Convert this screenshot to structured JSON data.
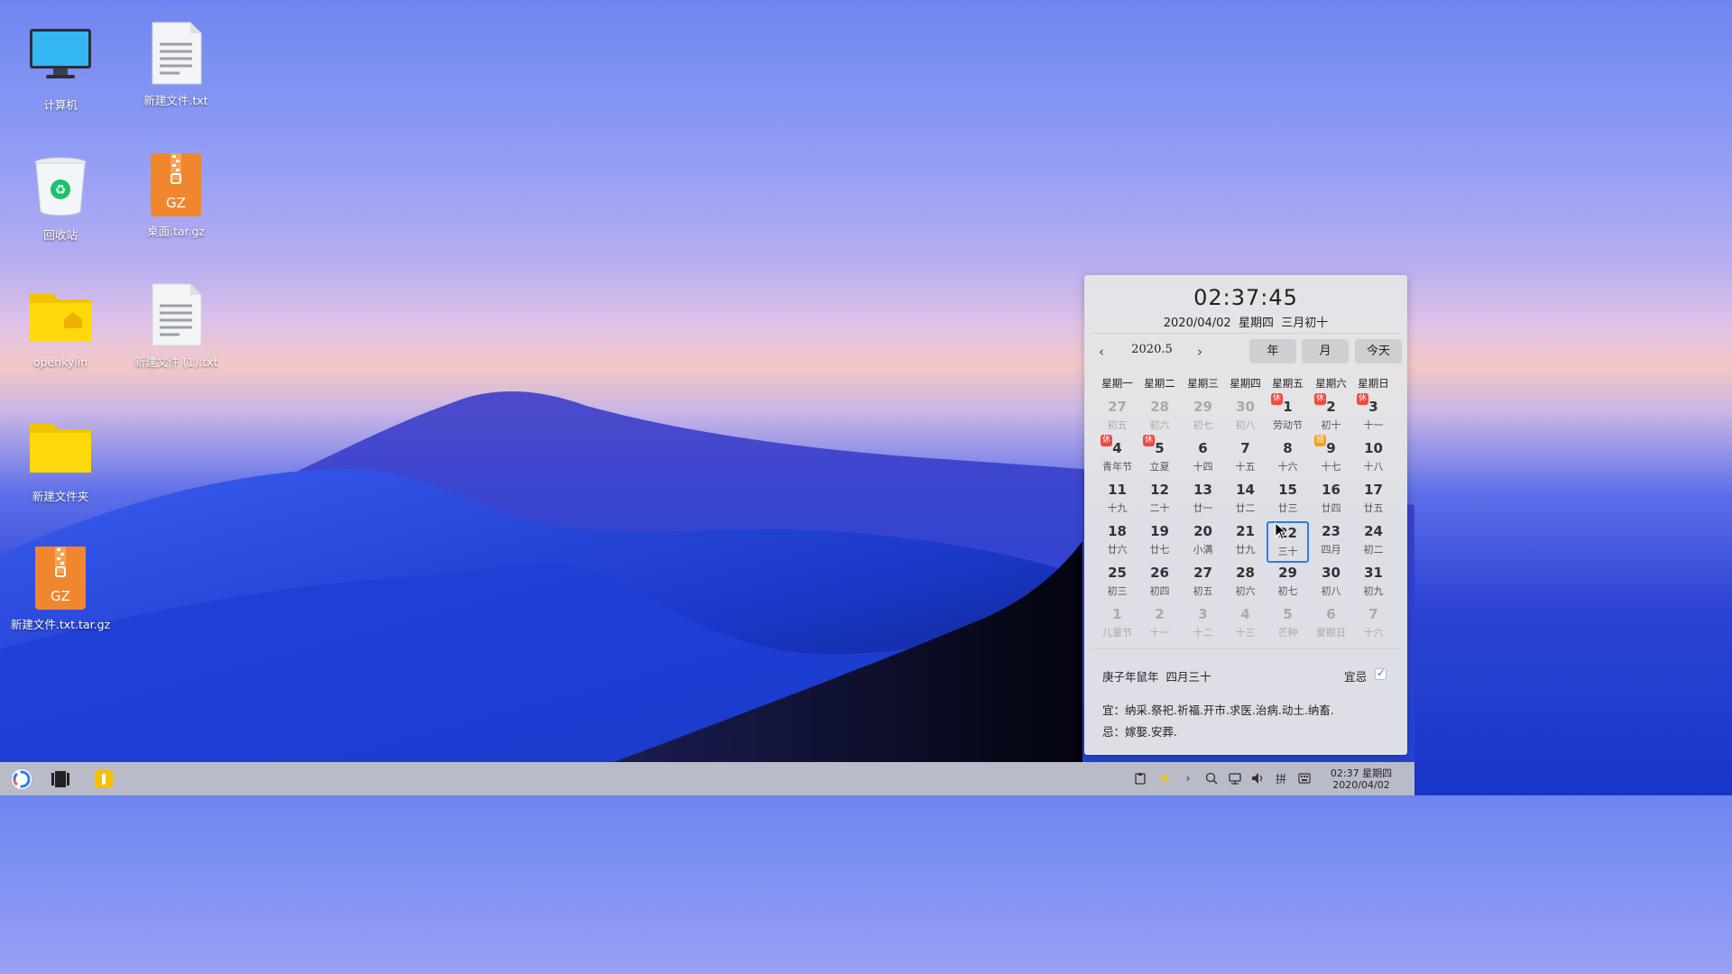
{
  "desktop": {
    "icons": [
      {
        "label": "计算机",
        "icon": "computer-icon"
      },
      {
        "label": "新建文件.txt",
        "icon": "text-file-icon"
      },
      {
        "label": "回收站",
        "icon": "trash-icon"
      },
      {
        "label": "桌面.tar.gz",
        "icon": "archive-icon",
        "badge": "GZ"
      },
      {
        "label": "openkylin",
        "icon": "home-folder-icon"
      },
      {
        "label": "新建文件 (1).txt",
        "icon": "text-file-icon"
      },
      {
        "label": "新建文件夹",
        "icon": "folder-icon"
      },
      {
        "label": "新建文件.txt.tar.gz",
        "icon": "archive-icon",
        "badge": "GZ"
      }
    ]
  },
  "calendar": {
    "time": "02:37:45",
    "date_line": "2020/04/02  星期四  三月初十",
    "month_label": "2020.5",
    "prev": "‹",
    "next": "›",
    "year_btn": "年",
    "month_btn": "月",
    "today_btn": "今天",
    "weekdays": [
      "星期一",
      "星期二",
      "星期三",
      "星期四",
      "星期五",
      "星期六",
      "星期日"
    ],
    "days": [
      {
        "n": "27",
        "l": "初五",
        "other": true
      },
      {
        "n": "28",
        "l": "初六",
        "other": true
      },
      {
        "n": "29",
        "l": "初七",
        "other": true
      },
      {
        "n": "30",
        "l": "初八",
        "other": true
      },
      {
        "n": "1",
        "l": "劳动节",
        "badge": "休",
        "badge_type": "rest"
      },
      {
        "n": "2",
        "l": "初十",
        "badge": "休",
        "badge_type": "rest"
      },
      {
        "n": "3",
        "l": "十一",
        "badge": "休",
        "badge_type": "rest"
      },
      {
        "n": "4",
        "l": "青年节",
        "badge": "休",
        "badge_type": "rest"
      },
      {
        "n": "5",
        "l": "立夏",
        "badge": "休",
        "badge_type": "rest"
      },
      {
        "n": "6",
        "l": "十四"
      },
      {
        "n": "7",
        "l": "十五"
      },
      {
        "n": "8",
        "l": "十六"
      },
      {
        "n": "9",
        "l": "十七",
        "badge": "班",
        "badge_type": "work"
      },
      {
        "n": "10",
        "l": "十八"
      },
      {
        "n": "11",
        "l": "十九"
      },
      {
        "n": "12",
        "l": "二十"
      },
      {
        "n": "13",
        "l": "廿一"
      },
      {
        "n": "14",
        "l": "廿二"
      },
      {
        "n": "15",
        "l": "廿三"
      },
      {
        "n": "16",
        "l": "廿四"
      },
      {
        "n": "17",
        "l": "廿五"
      },
      {
        "n": "18",
        "l": "廿六"
      },
      {
        "n": "19",
        "l": "廿七"
      },
      {
        "n": "20",
        "l": "小满"
      },
      {
        "n": "21",
        "l": "廿九"
      },
      {
        "n": "22",
        "l": "三十",
        "selected": true
      },
      {
        "n": "23",
        "l": "四月"
      },
      {
        "n": "24",
        "l": "初二"
      },
      {
        "n": "25",
        "l": "初三"
      },
      {
        "n": "26",
        "l": "初四"
      },
      {
        "n": "27",
        "l": "初五"
      },
      {
        "n": "28",
        "l": "初六"
      },
      {
        "n": "29",
        "l": "初七"
      },
      {
        "n": "30",
        "l": "初八"
      },
      {
        "n": "31",
        "l": "初九"
      },
      {
        "n": "1",
        "l": "儿童节",
        "other": true
      },
      {
        "n": "2",
        "l": "十一",
        "other": true
      },
      {
        "n": "3",
        "l": "十二",
        "other": true
      },
      {
        "n": "4",
        "l": "十三",
        "other": true
      },
      {
        "n": "5",
        "l": "芒种",
        "other": true
      },
      {
        "n": "6",
        "l": "爱眼日",
        "other": true
      },
      {
        "n": "7",
        "l": "十六",
        "other": true
      }
    ],
    "lunar_year": "庚子年鼠年  四月三十",
    "yiji_label": "宜忌",
    "yiji_checked": true,
    "yi": "宜：纳采.祭祀.祈福.开市.求医.治病.动土.纳畜.",
    "ji": "忌：嫁娶.安葬."
  },
  "taskbar": {
    "start": "start-menu-icon",
    "multitask": "multitask-view-icon",
    "running": "file-manager-icon",
    "tray": [
      "clipboard-icon",
      "brightness-icon",
      "expand-arrow-icon",
      "search-icon",
      "network-icon",
      "volume-icon",
      "input-method-icon",
      "keyboard-icon"
    ],
    "input_method": "拼",
    "expand": "›",
    "clock_time": "02:37 星期四",
    "clock_date": "2020/04/02"
  },
  "colors": {
    "accent": "#2b7cf0",
    "rest_badge": "#f2483e",
    "work_badge": "#f2a21a"
  }
}
